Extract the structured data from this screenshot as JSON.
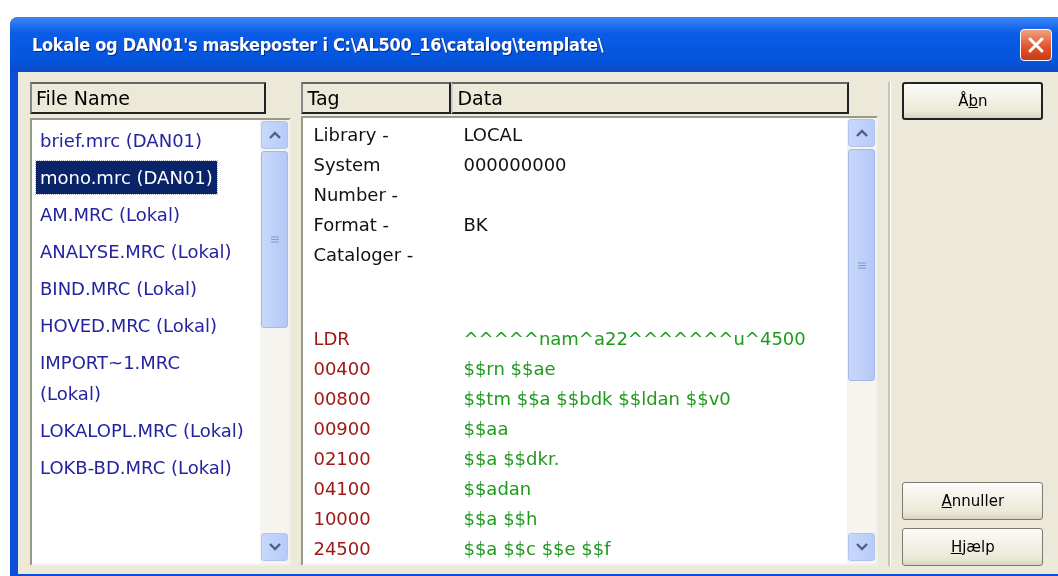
{
  "window": {
    "title": "Lokale og DAN01's maskeposter i C:\\AL500_16\\catalog\\template\\"
  },
  "file_list": {
    "column": "File Name",
    "items": [
      {
        "label": "brief.mrc (DAN01)",
        "selected": false
      },
      {
        "label": "mono.mrc (DAN01)",
        "selected": true
      },
      {
        "label": "AM.MRC (Lokal)",
        "selected": false
      },
      {
        "label": "ANALYSE.MRC (Lokal)",
        "selected": false
      },
      {
        "label": "BIND.MRC (Lokal)",
        "selected": false
      },
      {
        "label": "HOVED.MRC (Lokal)",
        "selected": false
      },
      {
        "label": "IMPORT~1.MRC (Lokal)",
        "selected": false
      },
      {
        "label": "LOKALOPL.MRC (Lokal)",
        "selected": false
      },
      {
        "label": "LOKB-BD.MRC (Lokal)",
        "selected": false
      }
    ]
  },
  "record": {
    "columns": [
      "Tag",
      "Data"
    ],
    "info_rows": [
      {
        "tag": "Library -",
        "data": "LOCAL"
      },
      {
        "tag": "System Number -",
        "data": "000000000"
      },
      {
        "tag": "Format -",
        "data": "BK"
      },
      {
        "tag": "Cataloger -"
      }
    ],
    "marc_rows": [
      {
        "tag": "LDR",
        "data": "^^^^^nam^a22^^^^^^^u^4500"
      },
      {
        "tag": "00400",
        "data": "$$rn $$ae"
      },
      {
        "tag": "00800",
        "data": "$$tm $$a $$bdk $$ldan $$v0"
      },
      {
        "tag": "00900",
        "data": "$$aa"
      },
      {
        "tag": "02100",
        "data": "$$a $$dkr."
      },
      {
        "tag": "04100",
        "data": "$$adan"
      },
      {
        "tag": "10000",
        "data": "$$a $$h"
      },
      {
        "tag": "24500",
        "data": "$$a $$c $$e $$f"
      }
    ]
  },
  "buttons": [
    {
      "kind": "top",
      "default": true,
      "label_parts": [
        {
          "text": "Å",
          "underlined": false
        },
        {
          "text": "b",
          "underlined": true
        },
        {
          "text": "n",
          "underlined": false
        }
      ]
    },
    {
      "kind": "bottom",
      "default": false,
      "label_parts": [
        {
          "text": "A",
          "underlined": true
        },
        {
          "text": "nnuller",
          "underlined": false
        }
      ]
    },
    {
      "kind": "bottom",
      "default": false,
      "label_parts": [
        {
          "text": "H",
          "underlined": true
        },
        {
          "text": "jælp",
          "underlined": false
        }
      ]
    }
  ]
}
